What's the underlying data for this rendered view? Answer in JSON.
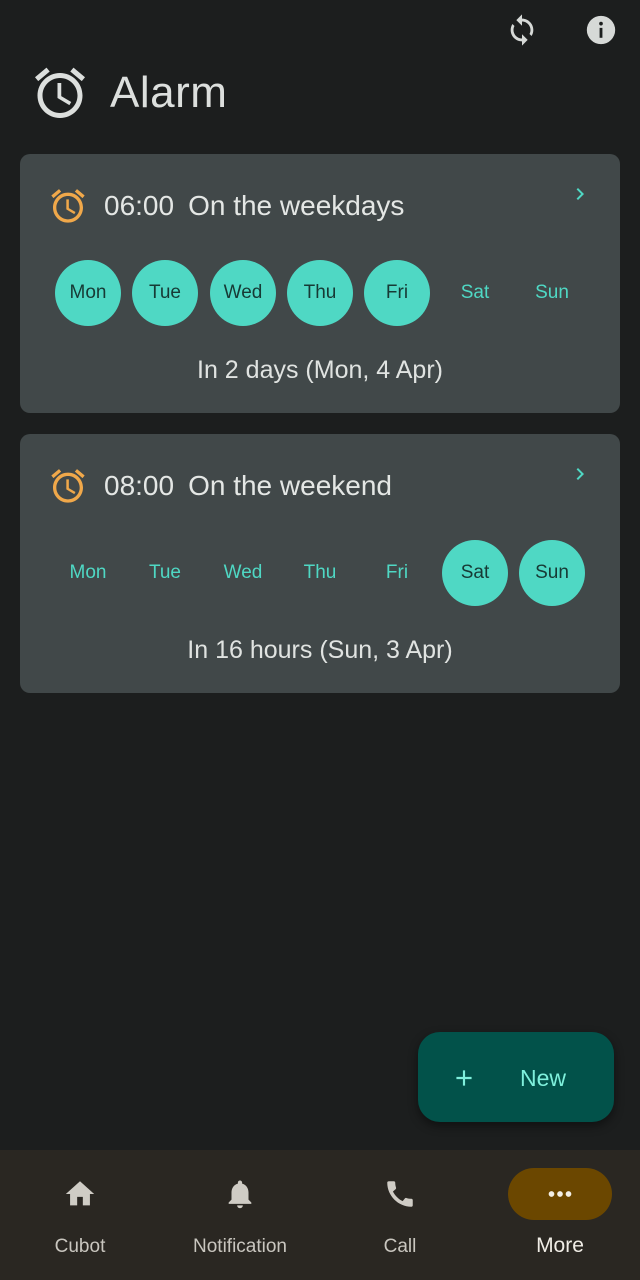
{
  "header": {
    "title": "Alarm",
    "icons": {
      "sync": "sync-icon",
      "info": "info-icon",
      "alarm": "alarm-clock-icon"
    }
  },
  "colors": {
    "accent": "#4fd8c4",
    "alarm_icon": "#f0a84a",
    "card_bg": "#414849",
    "fab_bg": "#02524a",
    "nav_active_bg": "#6b4700"
  },
  "alarms": [
    {
      "time": "06:00",
      "label": "On the weekdays",
      "next": "In 2 days (Mon, 4 Apr)",
      "days": [
        {
          "label": "Mon",
          "on": true
        },
        {
          "label": "Tue",
          "on": true
        },
        {
          "label": "Wed",
          "on": true
        },
        {
          "label": "Thu",
          "on": true
        },
        {
          "label": "Fri",
          "on": true
        },
        {
          "label": "Sat",
          "on": false
        },
        {
          "label": "Sun",
          "on": false
        }
      ]
    },
    {
      "time": "08:00",
      "label": "On the weekend",
      "next": "In 16 hours (Sun, 3 Apr)",
      "days": [
        {
          "label": "Mon",
          "on": false
        },
        {
          "label": "Tue",
          "on": false
        },
        {
          "label": "Wed",
          "on": false
        },
        {
          "label": "Thu",
          "on": false
        },
        {
          "label": "Fri",
          "on": false
        },
        {
          "label": "Sat",
          "on": true
        },
        {
          "label": "Sun",
          "on": true
        }
      ]
    }
  ],
  "fab": {
    "label": "New",
    "icon": "plus-icon"
  },
  "nav": [
    {
      "label": "Cubot",
      "icon": "home-icon",
      "active": false
    },
    {
      "label": "Notification",
      "icon": "bell-icon",
      "active": false
    },
    {
      "label": "Call",
      "icon": "phone-icon",
      "active": false
    },
    {
      "label": "More",
      "icon": "more-horizontal-icon",
      "active": true
    }
  ]
}
